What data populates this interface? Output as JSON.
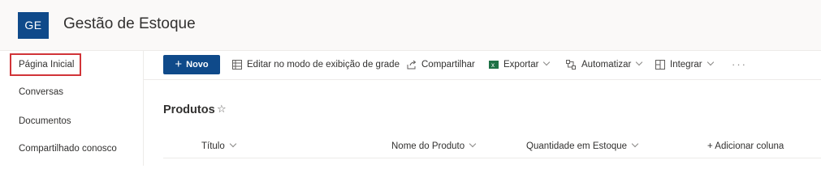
{
  "site": {
    "logo_text": "GE",
    "title": "Gestão de Estoque",
    "brand_color": "#0f4a8a"
  },
  "nav": {
    "items": [
      {
        "label": "Página Inicial",
        "selected": true
      },
      {
        "label": "Conversas"
      },
      {
        "label": "Documentos"
      },
      {
        "label": "Compartilhado conosco"
      }
    ]
  },
  "commandbar": {
    "new_label": "Novo",
    "grid_label": "Editar no modo de exibição de grade",
    "share_label": "Compartilhar",
    "export_label": "Exportar",
    "automate_label": "Automatizar",
    "integrate_label": "Integrar",
    "more_label": "···"
  },
  "list": {
    "title": "Produtos",
    "star": "☆",
    "columns": [
      "Título",
      "Nome do Produto",
      "Quantidade em Estoque"
    ],
    "add_column_label": "+ Adicionar coluna"
  },
  "icons": {
    "grid": "grid-icon",
    "share": "share-icon",
    "excel": "excel-icon",
    "automate": "automate-icon",
    "integrate": "integrate-icon"
  },
  "colors": {
    "highlight_border": "#d13438",
    "excel_green": "#1e7145"
  }
}
